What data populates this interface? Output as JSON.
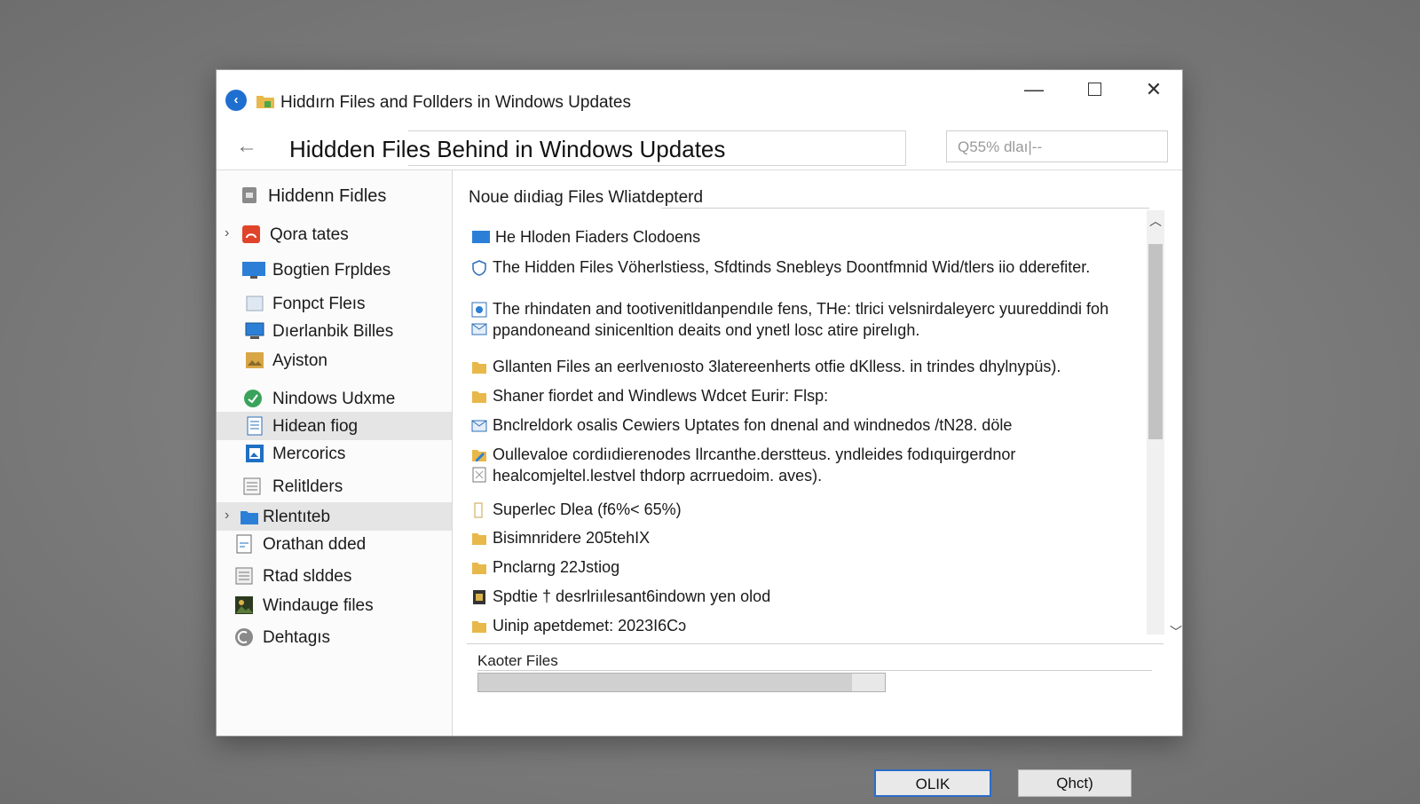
{
  "window": {
    "title": "Hiddırn Files and Follders in Windows Updates",
    "controls": {
      "minimize": "—",
      "close": "✕"
    }
  },
  "address_bar": {
    "path": "Hiddden Files Behind in Windows Updates",
    "search_placeholder": "Q55% dlaı|--"
  },
  "sidebar": {
    "items": [
      {
        "label": "Hiddenn Fidles",
        "icon": "drive-icon",
        "expandable": false,
        "selected": false
      },
      {
        "label": "Qora tates",
        "icon": "red-app-icon",
        "expandable": true,
        "selected": false
      },
      {
        "label": "Bogtien Frpldes",
        "icon": "monitor-icon",
        "expandable": false,
        "selected": false
      },
      {
        "label": "Fonpct Fleıs",
        "icon": "window-icon",
        "expandable": false,
        "selected": false
      },
      {
        "label": "Dıerlanbik Billes",
        "icon": "desktop-icon",
        "expandable": false,
        "selected": false
      },
      {
        "label": "Ayiston",
        "icon": "picture-folder-icon",
        "expandable": false,
        "selected": false
      },
      {
        "label": "Nindows Udxme",
        "icon": "green-globe-icon",
        "expandable": false,
        "selected": false
      },
      {
        "label": "Hidean fiog",
        "icon": "document-icon",
        "expandable": false,
        "selected": true
      },
      {
        "label": "Mercorics",
        "icon": "image-icon",
        "expandable": false,
        "selected": false
      },
      {
        "label": "Relitlders",
        "icon": "notepad-icon",
        "expandable": false,
        "selected": false
      },
      {
        "label": "Rlentıteb",
        "icon": "blue-folder-icon",
        "expandable": true,
        "selected": true
      },
      {
        "label": "Orathan dded",
        "icon": "page-icon",
        "expandable": false,
        "selected": false
      },
      {
        "label": "Rtad slddes",
        "icon": "list-icon",
        "expandable": false,
        "selected": false
      },
      {
        "label": "Windauge files",
        "icon": "photo-icon",
        "expandable": false,
        "selected": false
      },
      {
        "label": "Dehtagıs",
        "icon": "settings-circle-icon",
        "expandable": false,
        "selected": false
      }
    ]
  },
  "main": {
    "heading": "Noue diıdiag Files Wliatdepterd",
    "rows": [
      {
        "icon": "monitor-icon",
        "line1": "He Hloden Fiaders Clodoens",
        "line2": ""
      },
      {
        "icon": "shield-icon",
        "line1": "The Hidden Files Vöherlstiess, Sfdtinds Snebleys Doontfmnid Wid/tlers iio dderefiter.",
        "line2": ""
      },
      {
        "icon": "settings-doc-icon",
        "line1": "The rhindaten and tootivenitldanpendıle fens, THe: tlrici velsnirdaleyerc yuureddindi foh",
        "line2": "ppandoneand sinicenltion deaits ond ynetl losc atire pirelıgh."
      },
      {
        "icon": "folder-icon",
        "line1": "Gllanten Files an eerlvenıosto 3latereenherts otfie dKlless. in trindes dhylnypüs).",
        "line2": ""
      },
      {
        "icon": "folder-icon",
        "line1": "Shaner fiordet and Windlews Wdcet Eurir: Flsp:",
        "line2": ""
      },
      {
        "icon": "mail-icon",
        "line1": "Bnclreldork osalis Cewiers Uptates fon dnenal and windnedos /tN28. döle",
        "line2": ""
      },
      {
        "icon": "pencil-folder-icon",
        "line1": "Oullevaloe cordiıdierenodes Ilrcanthe.derstteus. yndleides fodıquirgerdnor",
        "line2": "healcomjeltel.lestvel thdorp acrruedoim. aves)."
      },
      {
        "icon": "blank-file-icon",
        "line1": "Superlec Dlea (f6%< 65%)",
        "line2": ""
      },
      {
        "icon": "folder-icon",
        "line1": "Bisimnridere 205tehIX",
        "line2": ""
      },
      {
        "icon": "folder-icon",
        "line1": "Pnclarng 22Jstiog",
        "line2": ""
      },
      {
        "icon": "dark-file-icon",
        "line1": "Spdtie † desrlriılesant6indown yen olod",
        "line2": ""
      },
      {
        "icon": "folder-icon",
        "line1": "Uinip apetdemet: 2023I6Cɔ",
        "line2": ""
      }
    ]
  },
  "footer": {
    "label": "Kaoter Files",
    "progress_fraction": 0.92,
    "ok_label": "OLIK",
    "cancel_label": "Qhct)"
  },
  "colors": {
    "accent": "#2b6cc7",
    "folder": "#e8b84a",
    "selection": "#e5e5e5",
    "background": "#7a7a7a"
  }
}
